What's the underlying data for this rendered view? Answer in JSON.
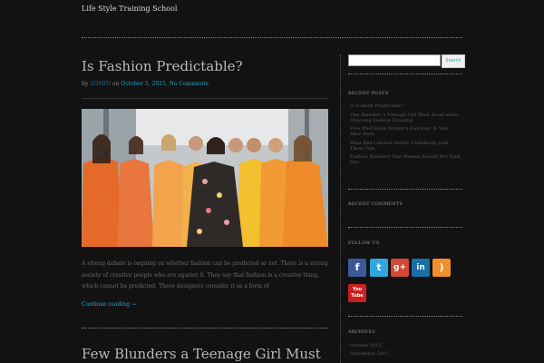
{
  "site": {
    "title": "Life Style Training School"
  },
  "post1": {
    "title": "Is Fashion Predictable?",
    "meta_by": "by",
    "author": "ADMIN",
    "meta_on": "on",
    "date": "October 5, 2015",
    "meta_sep": ",",
    "comments": "No Comments",
    "excerpt": "A strong debate is ongoing on whether fashion can be predicted or not. There is a strong society of creative people who are against it. They say that fashion is a creative thing, which cannot be predicted. These designers consider it as a form of",
    "continue": "Continue reading →"
  },
  "post2": {
    "title": "Few Blunders a Teenage Girl Must"
  },
  "sidebar": {
    "search_button": "Search",
    "search_value": "",
    "recent_posts_title": "RECENT POSTS",
    "recent_posts": [
      "Is Fashion Predictable?",
      "Few Blunders a Teenage Girl Must Avoid while Choosing Fashion Dressing",
      "Five Must Have Women's Footwear in Your Shoe Rack",
      "Wear Red Colored Outfits Confidently with These Tips",
      "Fashion Blunders That Women Should Not Turn Into"
    ],
    "recent_comments_title": "RECENT COMMENTS",
    "follow_title": "FOLLOW US",
    "social": [
      {
        "icon": "facebook-icon",
        "glyph": "f",
        "color": "#3b5998"
      },
      {
        "icon": "twitter-icon",
        "glyph": "t",
        "color": "#2fa8e0"
      },
      {
        "icon": "google-plus-icon",
        "glyph": "g+",
        "color": "#d34836"
      },
      {
        "icon": "linkedin-icon",
        "glyph": "in",
        "color": "#1a6fa8"
      },
      {
        "icon": "rss-icon",
        "glyph": ")",
        "color": "#f0902a"
      },
      {
        "icon": "youtube-icon",
        "glyph": "You Tube",
        "color": "#cc2020"
      }
    ],
    "archives_title": "ARCHIVES",
    "archives": [
      "October 2015",
      "September 2015"
    ]
  }
}
